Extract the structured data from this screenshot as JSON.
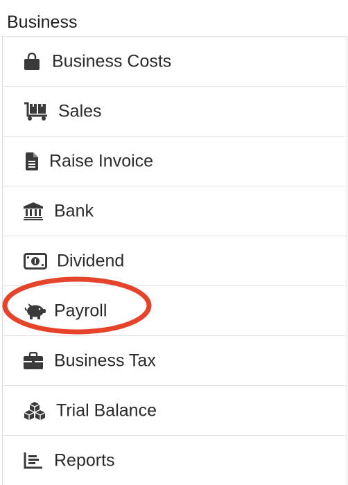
{
  "section": {
    "title": "Business"
  },
  "menu": {
    "items": [
      {
        "label": "Business Costs",
        "icon": "shopping-bag-icon"
      },
      {
        "label": "Sales",
        "icon": "dolly-cart-icon"
      },
      {
        "label": "Raise Invoice",
        "icon": "file-document-icon"
      },
      {
        "label": "Bank",
        "icon": "bank-building-icon"
      },
      {
        "label": "Dividend",
        "icon": "money-bill-icon"
      },
      {
        "label": "Payroll",
        "icon": "piggy-bank-icon",
        "highlighted": true
      },
      {
        "label": "Business Tax",
        "icon": "briefcase-icon"
      },
      {
        "label": "Trial Balance",
        "icon": "cubes-icon"
      },
      {
        "label": "Reports",
        "icon": "chart-bar-icon"
      }
    ]
  },
  "colors": {
    "icon": "#3a3a3a",
    "text": "#2a2a2a",
    "divider": "#e2e2e2",
    "highlight_circle": "#e5432a"
  }
}
